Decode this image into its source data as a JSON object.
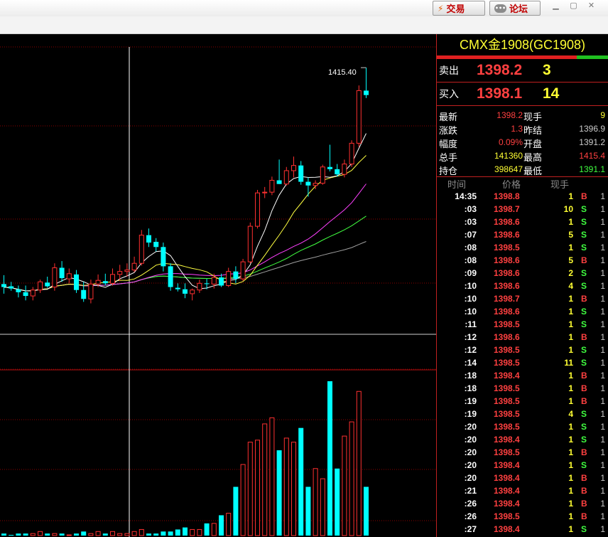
{
  "toolbar": {
    "trade_label": "交易",
    "forum_label": "论坛",
    "trade_icon": "lightning-icon",
    "forum_icon": "chat-bubble-icon",
    "window_controls": [
      "minimize-icon",
      "restore-icon",
      "close-icon"
    ]
  },
  "chart": {
    "high_label": "1415.40",
    "colors": {
      "up": "#ff3030",
      "down": "#00ffff",
      "ma_white": "#ffffff",
      "ma_yellow": "#ffff40",
      "ma_magenta": "#ff40ff",
      "ma_green": "#40ff40",
      "ma_gray": "#a0a0a0",
      "grid": "#8b0000"
    }
  },
  "chart_data": {
    "type": "candlestick",
    "title": "",
    "high_annotation": 1415.4,
    "price_range": [
      1380,
      1418
    ],
    "candles": [
      {
        "o": 1386.2,
        "h": 1387.4,
        "l": 1384.9,
        "c": 1385.8
      },
      {
        "o": 1385.9,
        "h": 1386.5,
        "l": 1385.3,
        "c": 1385.6
      },
      {
        "o": 1385.5,
        "h": 1386.0,
        "l": 1384.4,
        "c": 1385.1
      },
      {
        "o": 1385.1,
        "h": 1386.0,
        "l": 1384.0,
        "c": 1384.6
      },
      {
        "o": 1384.6,
        "h": 1385.8,
        "l": 1384.0,
        "c": 1385.4
      },
      {
        "o": 1385.4,
        "h": 1386.8,
        "l": 1385.0,
        "c": 1386.5
      },
      {
        "o": 1386.4,
        "h": 1387.2,
        "l": 1385.7,
        "c": 1385.9
      },
      {
        "o": 1385.8,
        "h": 1389.0,
        "l": 1385.3,
        "c": 1388.4
      },
      {
        "o": 1388.4,
        "h": 1389.3,
        "l": 1386.5,
        "c": 1387.0
      },
      {
        "o": 1386.9,
        "h": 1388.3,
        "l": 1386.3,
        "c": 1387.6
      },
      {
        "o": 1387.5,
        "h": 1388.1,
        "l": 1385.0,
        "c": 1385.4
      },
      {
        "o": 1385.4,
        "h": 1386.5,
        "l": 1383.8,
        "c": 1384.2
      },
      {
        "o": 1384.2,
        "h": 1386.8,
        "l": 1383.6,
        "c": 1386.2
      },
      {
        "o": 1386.2,
        "h": 1387.5,
        "l": 1385.8,
        "c": 1386.7
      },
      {
        "o": 1386.6,
        "h": 1387.6,
        "l": 1386.0,
        "c": 1386.3
      },
      {
        "o": 1386.3,
        "h": 1388.3,
        "l": 1386.0,
        "c": 1387.5
      },
      {
        "o": 1387.5,
        "h": 1388.8,
        "l": 1386.6,
        "c": 1387.9
      },
      {
        "o": 1387.9,
        "h": 1389.0,
        "l": 1387.2,
        "c": 1388.1
      },
      {
        "o": 1388.1,
        "h": 1389.9,
        "l": 1387.8,
        "c": 1389.0
      },
      {
        "o": 1389.0,
        "h": 1393.5,
        "l": 1388.7,
        "c": 1392.8
      },
      {
        "o": 1392.8,
        "h": 1393.7,
        "l": 1391.2,
        "c": 1391.8
      },
      {
        "o": 1391.9,
        "h": 1392.4,
        "l": 1390.6,
        "c": 1391.2
      },
      {
        "o": 1391.2,
        "h": 1391.8,
        "l": 1387.9,
        "c": 1388.6
      },
      {
        "o": 1388.6,
        "h": 1389.0,
        "l": 1385.3,
        "c": 1385.8
      },
      {
        "o": 1385.7,
        "h": 1386.3,
        "l": 1385.2,
        "c": 1385.5
      },
      {
        "o": 1385.5,
        "h": 1386.3,
        "l": 1384.3,
        "c": 1384.9
      },
      {
        "o": 1384.9,
        "h": 1385.6,
        "l": 1384.0,
        "c": 1385.4
      },
      {
        "o": 1385.4,
        "h": 1386.8,
        "l": 1385.0,
        "c": 1386.3
      },
      {
        "o": 1386.3,
        "h": 1386.9,
        "l": 1385.5,
        "c": 1386.2
      },
      {
        "o": 1386.2,
        "h": 1387.6,
        "l": 1385.6,
        "c": 1387.1
      },
      {
        "o": 1387.1,
        "h": 1387.6,
        "l": 1385.8,
        "c": 1386.0
      },
      {
        "o": 1386.0,
        "h": 1388.4,
        "l": 1385.8,
        "c": 1387.9
      },
      {
        "o": 1387.9,
        "h": 1388.6,
        "l": 1386.3,
        "c": 1386.9
      },
      {
        "o": 1386.9,
        "h": 1389.6,
        "l": 1386.6,
        "c": 1389.2
      },
      {
        "o": 1389.2,
        "h": 1394.5,
        "l": 1389.0,
        "c": 1394.0
      },
      {
        "o": 1394.0,
        "h": 1398.9,
        "l": 1393.7,
        "c": 1398.5
      },
      {
        "o": 1398.5,
        "h": 1399.3,
        "l": 1397.8,
        "c": 1398.6
      },
      {
        "o": 1398.6,
        "h": 1400.7,
        "l": 1398.2,
        "c": 1400.2
      },
      {
        "o": 1400.2,
        "h": 1403.0,
        "l": 1399.7,
        "c": 1399.7
      },
      {
        "o": 1399.7,
        "h": 1402.0,
        "l": 1399.5,
        "c": 1401.5
      },
      {
        "o": 1401.5,
        "h": 1403.4,
        "l": 1400.6,
        "c": 1402.2
      },
      {
        "o": 1402.2,
        "h": 1402.8,
        "l": 1399.6,
        "c": 1400.0
      },
      {
        "o": 1400.0,
        "h": 1400.6,
        "l": 1398.0,
        "c": 1399.5
      },
      {
        "o": 1399.5,
        "h": 1400.2,
        "l": 1399.0,
        "c": 1399.8
      },
      {
        "o": 1399.8,
        "h": 1402.3,
        "l": 1399.6,
        "c": 1402.0
      },
      {
        "o": 1402.0,
        "h": 1405.0,
        "l": 1401.4,
        "c": 1401.7
      },
      {
        "o": 1401.7,
        "h": 1402.4,
        "l": 1400.7,
        "c": 1401.0
      },
      {
        "o": 1401.0,
        "h": 1403.0,
        "l": 1400.6,
        "c": 1402.4
      },
      {
        "o": 1402.4,
        "h": 1405.6,
        "l": 1402.0,
        "c": 1405.2
      },
      {
        "o": 1405.2,
        "h": 1413.0,
        "l": 1404.7,
        "c": 1412.3
      },
      {
        "o": 1412.3,
        "h": 1415.4,
        "l": 1411.3,
        "c": 1411.7
      }
    ],
    "volume": [
      1,
      0,
      1,
      1,
      1,
      2,
      1,
      1,
      1,
      0,
      1,
      2,
      1,
      2,
      1,
      2,
      1,
      1,
      2,
      3,
      1,
      1,
      2,
      2,
      3,
      4,
      3,
      3,
      6,
      6,
      10,
      11,
      24,
      35,
      46,
      47,
      55,
      58,
      42,
      48,
      46,
      53,
      24,
      33,
      28,
      76,
      33,
      49,
      56,
      71,
      24
    ]
  },
  "panel": {
    "contract": "CMX金1908(GC1908)",
    "ask_label": "卖出",
    "ask_price": "1398.2",
    "ask_vol": "3",
    "bid_label": "买入",
    "bid_price": "1398.1",
    "bid_vol": "14",
    "stats": [
      {
        "l1": "最新",
        "v1": "1398.2",
        "c1": "#ff4040",
        "l2": "现手",
        "v2": "9",
        "c2": "#ffff33"
      },
      {
        "l1": "涨跌",
        "v1": "1.3",
        "c1": "#ff4040",
        "l2": "昨结",
        "v2": "1396.9",
        "c2": "#cccccc"
      },
      {
        "l1": "幅度",
        "v1": "0.09%",
        "c1": "#ff4040",
        "l2": "开盘",
        "v2": "1391.2",
        "c2": "#cccccc"
      },
      {
        "l1": "总手",
        "v1": "141360",
        "c1": "#ffff33",
        "l2": "最高",
        "v2": "1415.4",
        "c2": "#ff4040"
      },
      {
        "l1": "持仓",
        "v1": "398647",
        "c1": "#ffff33",
        "l2": "最低",
        "v2": "1391.1",
        "c2": "#40ff40"
      }
    ],
    "ticks_header": {
      "time": "时间",
      "price": "价格",
      "vol": "现手"
    },
    "ticks": [
      {
        "t": "14:35",
        "p": "1398.8",
        "v": "1",
        "s": "B",
        "o": "1"
      },
      {
        "t": ":03",
        "p": "1398.7",
        "v": "10",
        "s": "S",
        "o": "1"
      },
      {
        "t": ":03",
        "p": "1398.6",
        "v": "1",
        "s": "S",
        "o": "1"
      },
      {
        "t": ":07",
        "p": "1398.6",
        "v": "5",
        "s": "S",
        "o": "1"
      },
      {
        "t": ":08",
        "p": "1398.5",
        "v": "1",
        "s": "S",
        "o": "1"
      },
      {
        "t": ":08",
        "p": "1398.6",
        "v": "5",
        "s": "B",
        "o": "1"
      },
      {
        "t": ":09",
        "p": "1398.6",
        "v": "2",
        "s": "S",
        "o": "1"
      },
      {
        "t": ":10",
        "p": "1398.6",
        "v": "4",
        "s": "S",
        "o": "1"
      },
      {
        "t": ":10",
        "p": "1398.7",
        "v": "1",
        "s": "B",
        "o": "1"
      },
      {
        "t": ":10",
        "p": "1398.6",
        "v": "1",
        "s": "S",
        "o": "1"
      },
      {
        "t": ":11",
        "p": "1398.5",
        "v": "1",
        "s": "S",
        "o": "1"
      },
      {
        "t": ":12",
        "p": "1398.6",
        "v": "1",
        "s": "B",
        "o": "1"
      },
      {
        "t": ":12",
        "p": "1398.5",
        "v": "1",
        "s": "S",
        "o": "1"
      },
      {
        "t": ":14",
        "p": "1398.5",
        "v": "11",
        "s": "S",
        "o": "1"
      },
      {
        "t": ":18",
        "p": "1398.4",
        "v": "1",
        "s": "B",
        "o": "1"
      },
      {
        "t": ":18",
        "p": "1398.5",
        "v": "1",
        "s": "B",
        "o": "1"
      },
      {
        "t": ":19",
        "p": "1398.5",
        "v": "1",
        "s": "B",
        "o": "1"
      },
      {
        "t": ":19",
        "p": "1398.5",
        "v": "4",
        "s": "S",
        "o": "1"
      },
      {
        "t": ":20",
        "p": "1398.5",
        "v": "1",
        "s": "S",
        "o": "1"
      },
      {
        "t": ":20",
        "p": "1398.4",
        "v": "1",
        "s": "S",
        "o": "1"
      },
      {
        "t": ":20",
        "p": "1398.5",
        "v": "1",
        "s": "B",
        "o": "1"
      },
      {
        "t": ":20",
        "p": "1398.4",
        "v": "1",
        "s": "S",
        "o": "1"
      },
      {
        "t": ":20",
        "p": "1398.4",
        "v": "1",
        "s": "B",
        "o": "1"
      },
      {
        "t": ":21",
        "p": "1398.4",
        "v": "1",
        "s": "B",
        "o": "1"
      },
      {
        "t": ":26",
        "p": "1398.4",
        "v": "1",
        "s": "B",
        "o": "1"
      },
      {
        "t": ":26",
        "p": "1398.5",
        "v": "1",
        "s": "B",
        "o": "1"
      },
      {
        "t": ":27",
        "p": "1398.4",
        "v": "1",
        "s": "S",
        "o": "1"
      }
    ]
  }
}
